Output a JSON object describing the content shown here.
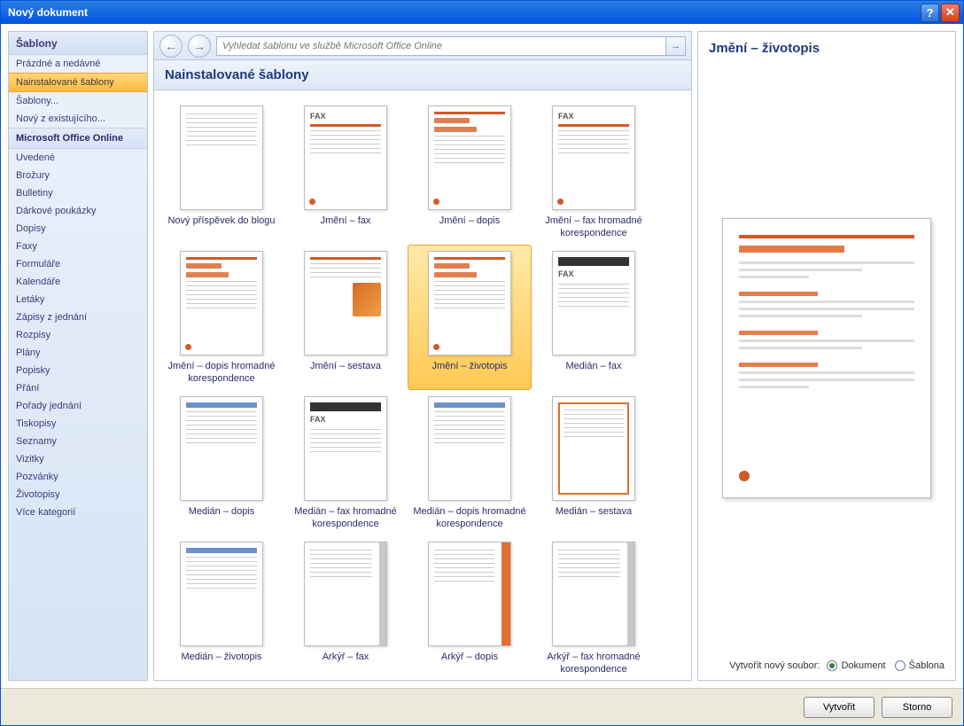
{
  "window": {
    "title": "Nový dokument"
  },
  "sidebar": {
    "heading": "Šablony",
    "top_items": [
      {
        "label": "Prázdné a nedávné"
      },
      {
        "label": "Nainstalované šablony",
        "selected": true
      },
      {
        "label": "Šablony..."
      },
      {
        "label": "Nový z existujícího..."
      }
    ],
    "section": "Microsoft Office Online",
    "online_items": [
      {
        "label": "Uvedené"
      },
      {
        "label": "Brožury"
      },
      {
        "label": "Bulletiny"
      },
      {
        "label": "Dárkové poukázky"
      },
      {
        "label": "Dopisy"
      },
      {
        "label": "Faxy"
      },
      {
        "label": "Formuláře"
      },
      {
        "label": "Kalendáře"
      },
      {
        "label": "Letáky"
      },
      {
        "label": "Zápisy z jednání"
      },
      {
        "label": "Rozpisy"
      },
      {
        "label": "Plány"
      },
      {
        "label": "Popisky"
      },
      {
        "label": "Přání"
      },
      {
        "label": "Pořady jednání"
      },
      {
        "label": "Tiskopisy"
      },
      {
        "label": "Seznamy"
      },
      {
        "label": "Vizitky"
      },
      {
        "label": "Pozvánky"
      },
      {
        "label": "Životopisy"
      },
      {
        "label": "Více kategorií"
      }
    ]
  },
  "search": {
    "placeholder": "Vyhledat šablonu ve službě Microsoft Office Online"
  },
  "content": {
    "header": "Nainstalované šablony",
    "templates": [
      {
        "label": "Nový příspěvek do blogu",
        "style": "plain"
      },
      {
        "label": "Jmění – fax",
        "style": "fax-orange"
      },
      {
        "label": "Jmění – dopis",
        "style": "orange-top"
      },
      {
        "label": "Jmění – fax hromadné korespondence",
        "style": "fax-orange"
      },
      {
        "label": "Jmění – dopis hromadné korespondence",
        "style": "orange-top"
      },
      {
        "label": "Jmění – sestava",
        "style": "orange-top-pic"
      },
      {
        "label": "Jmění – životopis",
        "style": "orange-top",
        "selected": true
      },
      {
        "label": "Medián – fax",
        "style": "fax-dark"
      },
      {
        "label": "Medián – dopis",
        "style": "blue-top"
      },
      {
        "label": "Medián – fax hromadné korespondence",
        "style": "fax-dark"
      },
      {
        "label": "Medián – dopis hromadné korespondence",
        "style": "blue-top"
      },
      {
        "label": "Medián – sestava",
        "style": "orange-outline"
      },
      {
        "label": "Medián – životopis",
        "style": "blue-top"
      },
      {
        "label": "Arkýř – fax",
        "style": "side-gray"
      },
      {
        "label": "Arkýř – dopis",
        "style": "side-orange"
      },
      {
        "label": "Arkýř – fax hromadné korespondence",
        "style": "side-gray"
      }
    ]
  },
  "preview": {
    "title": "Jmění – životopis",
    "footer_label": "Vytvořit nový soubor:",
    "radio": {
      "doc": "Dokument",
      "tpl": "Šablona",
      "selected": "doc"
    }
  },
  "buttons": {
    "create": "Vytvořit",
    "cancel": "Storno"
  }
}
